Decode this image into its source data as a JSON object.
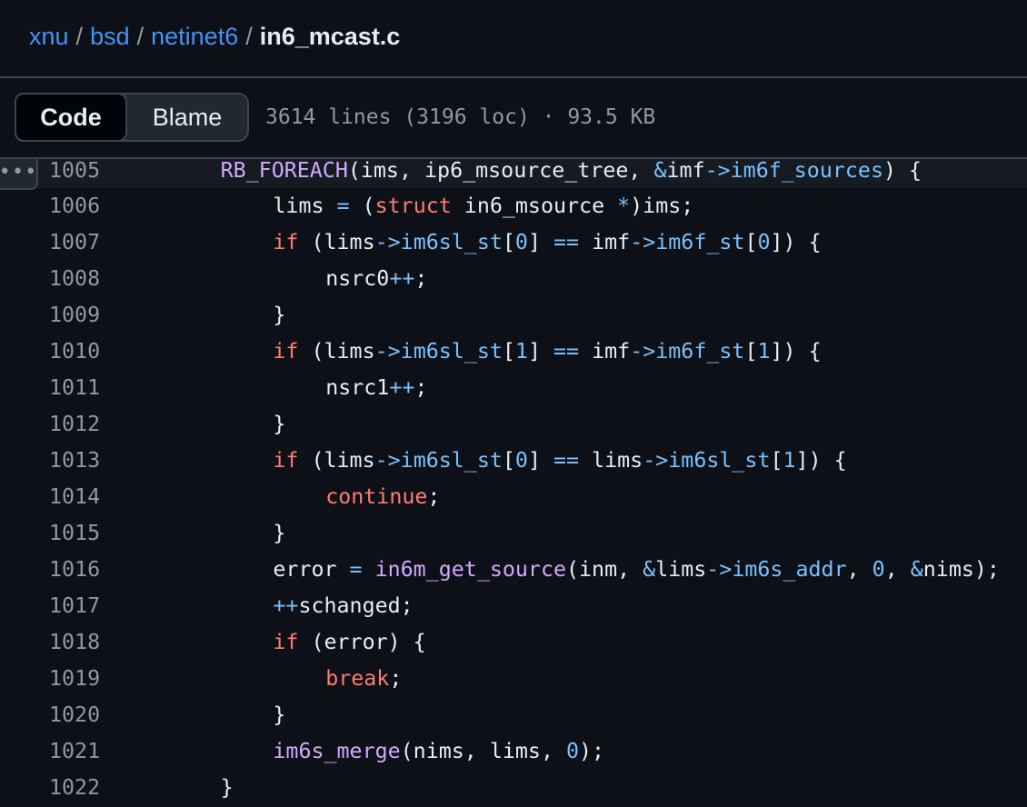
{
  "breadcrumb": {
    "repo": "xnu",
    "dir1": "bsd",
    "dir2": "netinet6",
    "file": "in6_mcast.c",
    "separator": "/"
  },
  "toolbar": {
    "code_tab": "Code",
    "blame_tab": "Blame",
    "file_meta": "3614 lines (3196 loc) · 93.5 KB"
  },
  "kebab_label": "•••",
  "colors": {
    "background": "#0d1117",
    "link": "#4493f8",
    "keyword": "#ff7b72",
    "function": "#d2a8ff",
    "constant": "#79c0ff",
    "text": "#e6edf3",
    "muted": "#9198a1"
  },
  "lines": [
    {
      "num": "1005",
      "indent": 8,
      "tokens": [
        {
          "t": "RB_FOREACH",
          "c": "fn"
        },
        {
          "t": "(ims, ip6_msource_tree, "
        },
        {
          "t": "&",
          "c": "op"
        },
        {
          "t": "imf"
        },
        {
          "t": "->",
          "c": "op"
        },
        {
          "t": "im6f_sources",
          "c": "mem"
        },
        {
          "t": ") {"
        }
      ]
    },
    {
      "num": "1006",
      "indent": 12,
      "tokens": [
        {
          "t": "lims "
        },
        {
          "t": "=",
          "c": "op"
        },
        {
          "t": " ("
        },
        {
          "t": "struct",
          "c": "kw"
        },
        {
          "t": " in6_msource "
        },
        {
          "t": "*",
          "c": "op"
        },
        {
          "t": ")ims;"
        }
      ]
    },
    {
      "num": "1007",
      "indent": 12,
      "tokens": [
        {
          "t": "if",
          "c": "kw"
        },
        {
          "t": " (lims"
        },
        {
          "t": "->",
          "c": "op"
        },
        {
          "t": "im6sl_st",
          "c": "mem"
        },
        {
          "t": "["
        },
        {
          "t": "0",
          "c": "num"
        },
        {
          "t": "] "
        },
        {
          "t": "==",
          "c": "op"
        },
        {
          "t": " imf"
        },
        {
          "t": "->",
          "c": "op"
        },
        {
          "t": "im6f_st",
          "c": "mem"
        },
        {
          "t": "["
        },
        {
          "t": "0",
          "c": "num"
        },
        {
          "t": "]) {"
        }
      ]
    },
    {
      "num": "1008",
      "indent": 16,
      "tokens": [
        {
          "t": "nsrc0"
        },
        {
          "t": "++",
          "c": "op"
        },
        {
          "t": ";"
        }
      ]
    },
    {
      "num": "1009",
      "indent": 12,
      "tokens": [
        {
          "t": "}"
        }
      ]
    },
    {
      "num": "1010",
      "indent": 12,
      "tokens": [
        {
          "t": "if",
          "c": "kw"
        },
        {
          "t": " (lims"
        },
        {
          "t": "->",
          "c": "op"
        },
        {
          "t": "im6sl_st",
          "c": "mem"
        },
        {
          "t": "["
        },
        {
          "t": "1",
          "c": "num"
        },
        {
          "t": "] "
        },
        {
          "t": "==",
          "c": "op"
        },
        {
          "t": " imf"
        },
        {
          "t": "->",
          "c": "op"
        },
        {
          "t": "im6f_st",
          "c": "mem"
        },
        {
          "t": "["
        },
        {
          "t": "1",
          "c": "num"
        },
        {
          "t": "]) {"
        }
      ]
    },
    {
      "num": "1011",
      "indent": 16,
      "tokens": [
        {
          "t": "nsrc1"
        },
        {
          "t": "++",
          "c": "op"
        },
        {
          "t": ";"
        }
      ]
    },
    {
      "num": "1012",
      "indent": 12,
      "tokens": [
        {
          "t": "}"
        }
      ]
    },
    {
      "num": "1013",
      "indent": 12,
      "tokens": [
        {
          "t": "if",
          "c": "kw"
        },
        {
          "t": " (lims"
        },
        {
          "t": "->",
          "c": "op"
        },
        {
          "t": "im6sl_st",
          "c": "mem"
        },
        {
          "t": "["
        },
        {
          "t": "0",
          "c": "num"
        },
        {
          "t": "] "
        },
        {
          "t": "==",
          "c": "op"
        },
        {
          "t": " lims"
        },
        {
          "t": "->",
          "c": "op"
        },
        {
          "t": "im6sl_st",
          "c": "mem"
        },
        {
          "t": "["
        },
        {
          "t": "1",
          "c": "num"
        },
        {
          "t": "]) {"
        }
      ]
    },
    {
      "num": "1014",
      "indent": 16,
      "tokens": [
        {
          "t": "continue",
          "c": "kw"
        },
        {
          "t": ";"
        }
      ]
    },
    {
      "num": "1015",
      "indent": 12,
      "tokens": [
        {
          "t": "}"
        }
      ]
    },
    {
      "num": "1016",
      "indent": 12,
      "tokens": [
        {
          "t": "error "
        },
        {
          "t": "=",
          "c": "op"
        },
        {
          "t": " "
        },
        {
          "t": "in6m_get_source",
          "c": "fn"
        },
        {
          "t": "(inm, "
        },
        {
          "t": "&",
          "c": "op"
        },
        {
          "t": "lims"
        },
        {
          "t": "->",
          "c": "op"
        },
        {
          "t": "im6s_addr",
          "c": "mem"
        },
        {
          "t": ", "
        },
        {
          "t": "0",
          "c": "num"
        },
        {
          "t": ", "
        },
        {
          "t": "&",
          "c": "op"
        },
        {
          "t": "nims);"
        }
      ]
    },
    {
      "num": "1017",
      "indent": 12,
      "tokens": [
        {
          "t": "++",
          "c": "op"
        },
        {
          "t": "schanged;"
        }
      ]
    },
    {
      "num": "1018",
      "indent": 12,
      "tokens": [
        {
          "t": "if",
          "c": "kw"
        },
        {
          "t": " (error) {"
        }
      ]
    },
    {
      "num": "1019",
      "indent": 16,
      "tokens": [
        {
          "t": "break",
          "c": "kw"
        },
        {
          "t": ";"
        }
      ]
    },
    {
      "num": "1020",
      "indent": 12,
      "tokens": [
        {
          "t": "}"
        }
      ]
    },
    {
      "num": "1021",
      "indent": 12,
      "tokens": [
        {
          "t": "im6s_merge",
          "c": "fn"
        },
        {
          "t": "(nims, lims, "
        },
        {
          "t": "0",
          "c": "num"
        },
        {
          "t": ");"
        }
      ]
    },
    {
      "num": "1022",
      "indent": 8,
      "tokens": [
        {
          "t": "}"
        }
      ]
    }
  ]
}
